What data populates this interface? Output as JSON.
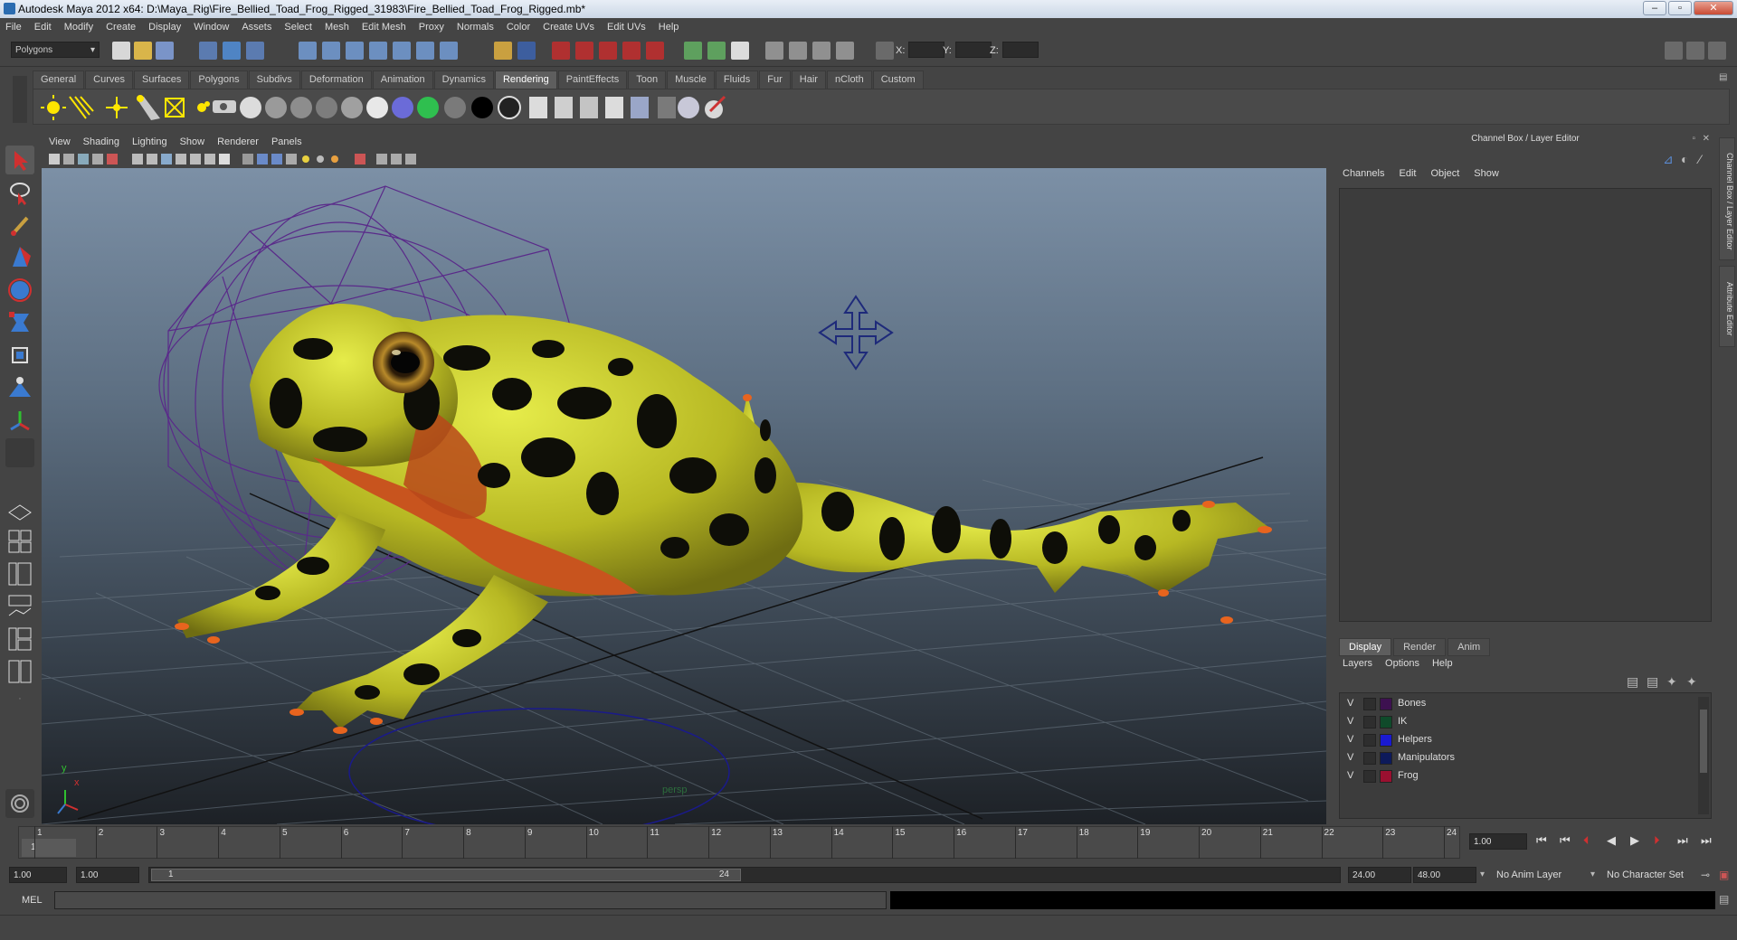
{
  "window": {
    "title": "Autodesk Maya 2012 x64: D:\\Maya_Rig\\Fire_Bellied_Toad_Frog_Rigged_31983\\Fire_Bellied_Toad_Frog_Rigged.mb*"
  },
  "menubar": [
    "File",
    "Edit",
    "Modify",
    "Create",
    "Display",
    "Window",
    "Assets",
    "Select",
    "Mesh",
    "Edit Mesh",
    "Proxy",
    "Normals",
    "Color",
    "Create UVs",
    "Edit UVs",
    "Help"
  ],
  "status": {
    "mode": "Polygons",
    "x_label": "X:",
    "y_label": "Y:",
    "z_label": "Z:"
  },
  "shelf_tabs": [
    "General",
    "Curves",
    "Surfaces",
    "Polygons",
    "Subdivs",
    "Deformation",
    "Animation",
    "Dynamics",
    "Rendering",
    "PaintEffects",
    "Toon",
    "Muscle",
    "Fluids",
    "Fur",
    "Hair",
    "nCloth",
    "Custom"
  ],
  "shelf_active": "Rendering",
  "viewport": {
    "menu": [
      "View",
      "Shading",
      "Lighting",
      "Show",
      "Renderer",
      "Panels"
    ],
    "camera_label": "persp",
    "axis_y": "y",
    "axis_x": "x"
  },
  "right_panel": {
    "title": "Channel Box / Layer Editor",
    "menu": [
      "Channels",
      "Edit",
      "Object",
      "Show"
    ],
    "tabs": [
      "Display",
      "Render",
      "Anim"
    ],
    "active_tab": "Display",
    "layer_menu": [
      "Layers",
      "Options",
      "Help"
    ],
    "layers": [
      {
        "visible": "V",
        "name": "Bones",
        "color": "#3d1150"
      },
      {
        "visible": "V",
        "name": "IK",
        "color": "#0f4a2a"
      },
      {
        "visible": "V",
        "name": "Helpers",
        "color": "#1a1ad0"
      },
      {
        "visible": "V",
        "name": "Manipulators",
        "color": "#0d1a5a"
      },
      {
        "visible": "V",
        "name": "Frog",
        "color": "#9a1030"
      }
    ]
  },
  "side_tabs": [
    "Channel Box / Layer Editor",
    "Attribute Editor"
  ],
  "timeline": {
    "ticks": [
      "1",
      "2",
      "3",
      "4",
      "5",
      "6",
      "7",
      "8",
      "9",
      "10",
      "11",
      "12",
      "13",
      "14",
      "15",
      "16",
      "17",
      "18",
      "19",
      "20",
      "21",
      "22",
      "23",
      "24"
    ],
    "current_frame_label": "1",
    "current_time": "1.00"
  },
  "range": {
    "start": "1.00",
    "playback_start": "1.00",
    "slider_start": "1",
    "slider_end": "24",
    "playback_end": "24.00",
    "end": "48.00",
    "anim_layer": "No Anim Layer",
    "character_set": "No Character Set"
  },
  "cmdline": {
    "label": "MEL"
  }
}
